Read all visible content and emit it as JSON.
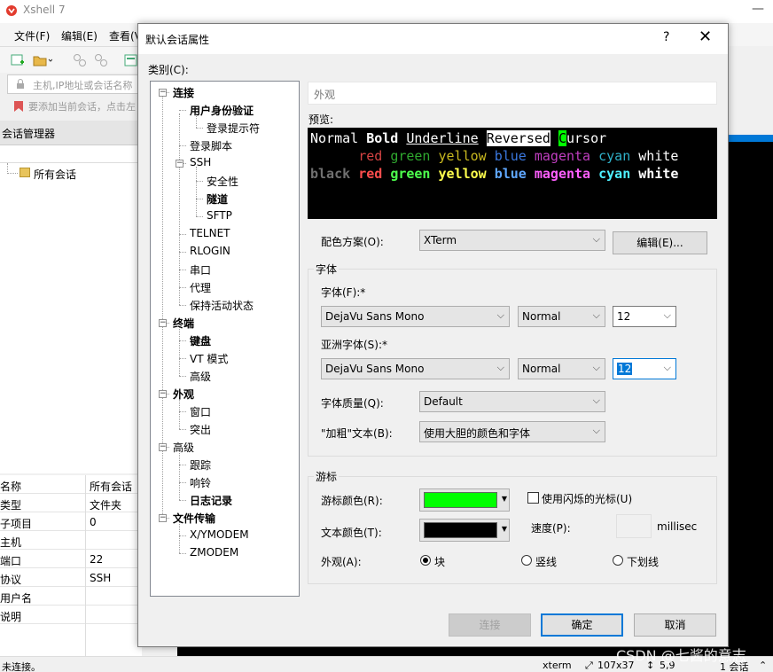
{
  "app": {
    "title": "Xshell 7",
    "minimize": "—",
    "menu": [
      "文件(F)",
      "编辑(E)",
      "查看(V"
    ],
    "address_placeholder": "主机,IP地址或会话名称",
    "add_hint": "要添加当前会话，点击左"
  },
  "session_manager": {
    "title": "会话管理器",
    "root": "所有会话"
  },
  "properties": [
    {
      "key": "名称",
      "value": "所有会话"
    },
    {
      "key": "类型",
      "value": "文件夹"
    },
    {
      "key": "子项目",
      "value": "0"
    },
    {
      "key": "主机",
      "value": ""
    },
    {
      "key": "端口",
      "value": "22"
    },
    {
      "key": "协议",
      "value": "SSH"
    },
    {
      "key": "用户名",
      "value": ""
    },
    {
      "key": "说明",
      "value": ""
    }
  ],
  "statusbar": {
    "left": "未连接。",
    "term": "xterm",
    "size": "107x37",
    "pos": "5,9",
    "sessions": "1 会话"
  },
  "watermark": "CSDN @七酱的意志",
  "dialog": {
    "title": "默认会话属性",
    "help": "?",
    "close": "✕",
    "category_label": "类别(C):",
    "tree": [
      {
        "label": "连接",
        "bold": true
      },
      {
        "label": "用户身份验证",
        "bold": true
      },
      {
        "label": "登录提示符",
        "bold": false
      },
      {
        "label": "登录脚本",
        "bold": false
      },
      {
        "label": "SSH",
        "bold": false
      },
      {
        "label": "安全性",
        "bold": false
      },
      {
        "label": "隧道",
        "bold": true
      },
      {
        "label": "SFTP",
        "bold": false
      },
      {
        "label": "TELNET",
        "bold": false
      },
      {
        "label": "RLOGIN",
        "bold": false
      },
      {
        "label": "串口",
        "bold": false
      },
      {
        "label": "代理",
        "bold": false
      },
      {
        "label": "保持活动状态",
        "bold": false
      },
      {
        "label": "终端",
        "bold": true
      },
      {
        "label": "键盘",
        "bold": true
      },
      {
        "label": "VT 模式",
        "bold": false
      },
      {
        "label": "高级",
        "bold": false
      },
      {
        "label": "外观",
        "bold": true
      },
      {
        "label": "窗口",
        "bold": false
      },
      {
        "label": "突出",
        "bold": false
      },
      {
        "label": "高级",
        "bold": false
      },
      {
        "label": "跟踪",
        "bold": false
      },
      {
        "label": "响铃",
        "bold": false
      },
      {
        "label": "日志记录",
        "bold": true
      },
      {
        "label": "文件传输",
        "bold": true
      },
      {
        "label": "X/YMODEM",
        "bold": false
      },
      {
        "label": "ZMODEM",
        "bold": false
      }
    ],
    "pane_title": "外观",
    "preview_label": "预览:",
    "preview": {
      "line1": [
        "Normal",
        "Bold",
        "Underline",
        "Reversed",
        "C",
        "ursor"
      ],
      "line2": [
        "red",
        "green",
        "yellow",
        "blue",
        "magenta",
        "cyan",
        "white"
      ],
      "line3": [
        "black",
        "red",
        "green",
        "yellow",
        "blue",
        "magenta",
        "cyan",
        "white"
      ]
    },
    "scheme_label": "配色方案(O):",
    "scheme_value": "XTerm",
    "edit_button": "编辑(E)...",
    "font_group": "字体",
    "font_label": "字体(F):*",
    "font_family": "DejaVu Sans Mono",
    "font_weight": "Normal",
    "font_size": "12",
    "asian_font_label": "亚洲字体(S):*",
    "asian_font_family": "DejaVu Sans Mono",
    "asian_font_weight": "Normal",
    "asian_font_size": "12",
    "quality_label": "字体质量(Q):",
    "quality_value": "Default",
    "bold_label": "\"加粗\"文本(B):",
    "bold_value": "使用大胆的颜色和字体",
    "cursor_group": "游标",
    "cursor_color_label": "游标颜色(R):",
    "cursor_color": "#00ff00",
    "text_color_label": "文本颜色(T):",
    "text_color": "#000000",
    "blink_label": "使用闪烁的光标(U)",
    "speed_label": "速度(P):",
    "speed_unit": "millisec",
    "shape_label": "外观(A):",
    "shapes": [
      "块",
      "竖线",
      "下划线"
    ],
    "shape_selected": "块",
    "connect_button": "连接",
    "ok_button": "确定",
    "cancel_button": "取消"
  }
}
